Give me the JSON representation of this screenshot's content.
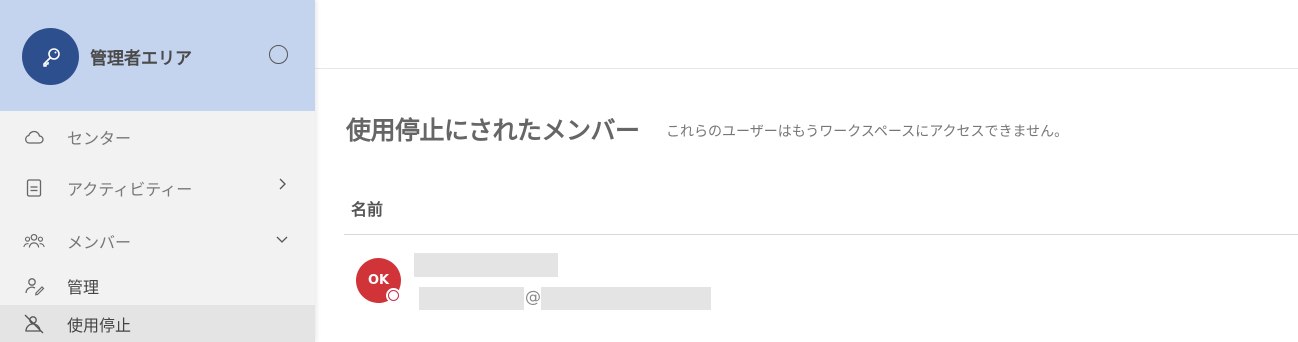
{
  "sidebar": {
    "header": {
      "title": "管理者エリア",
      "icon": "key-icon",
      "accent": "#2d4f8e",
      "background": "#c4d4ee"
    },
    "items": [
      {
        "label": "センター",
        "icon": "cloud-icon"
      },
      {
        "label": "アクティビティー",
        "icon": "document-icon",
        "chevron": "chevron-right-icon"
      },
      {
        "label": "メンバー",
        "icon": "people-icon",
        "chevron": "chevron-down-icon"
      }
    ],
    "subitems": [
      {
        "label": "管理",
        "icon": "person-edit-icon"
      },
      {
        "label": "使用停止",
        "icon": "person-block-icon",
        "active": true
      }
    ]
  },
  "main": {
    "title": "使用停止にされたメンバー",
    "subtitle": "これらのユーザーはもうワークスペースにアクセスできません。",
    "table": {
      "columns": [
        "名前"
      ],
      "rows": [
        {
          "initials": "OK",
          "avatar_color": "#d13438",
          "email_at": "@"
        }
      ]
    }
  }
}
